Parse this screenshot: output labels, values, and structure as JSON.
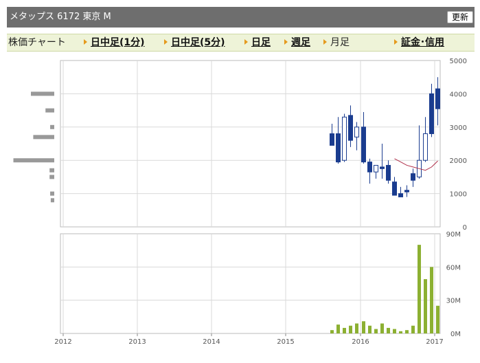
{
  "header": {
    "title": "メタップス 6172 東京 M",
    "refresh_label": "更新"
  },
  "nav": {
    "label": "株価チャート",
    "items": [
      {
        "label": "日中足(1分)",
        "link": true
      },
      {
        "label": "日中足(5分)",
        "link": true
      },
      {
        "label": "日足",
        "link": true
      },
      {
        "label": "週足",
        "link": true
      },
      {
        "label": "月足",
        "link": false
      },
      {
        "label": "証金･信用",
        "link": true
      }
    ]
  },
  "colors": {
    "down_candle": "#1a3c8f",
    "up_candle_fill": "#ffffff",
    "moving_average": "#b0304a",
    "volume_bar": "#8cb032",
    "volume_profile": "#999999",
    "grid": "#d9d9d9",
    "frame": "#bbbbbb"
  },
  "chart_data": [
    {
      "type": "candlestick",
      "x_ticks": [
        "2012",
        "2013",
        "2014",
        "2015",
        "2016",
        "2017"
      ],
      "y_ticks": [
        "0",
        "1000",
        "2000",
        "3000",
        "4000",
        "5000"
      ],
      "ylim": [
        0,
        5000
      ],
      "months": [
        "2015-08",
        "2015-09",
        "2015-10",
        "2015-11",
        "2015-12",
        "2016-01",
        "2016-02",
        "2016-03",
        "2016-04",
        "2016-05",
        "2016-06",
        "2016-07",
        "2016-08",
        "2016-09",
        "2016-10",
        "2016-11",
        "2016-12",
        "2017-01"
      ],
      "open": [
        2800,
        2800,
        2000,
        3350,
        2700,
        3000,
        1950,
        1650,
        1800,
        1850,
        1350,
        1000,
        1100,
        1600,
        1500,
        2000,
        4000,
        4150
      ],
      "high": [
        3100,
        3300,
        3400,
        3650,
        3150,
        3450,
        2050,
        1800,
        2500,
        2000,
        1500,
        1200,
        1250,
        1750,
        3050,
        3300,
        4300,
        4500
      ],
      "low": [
        2500,
        1900,
        1950,
        2400,
        2300,
        1900,
        1300,
        1450,
        1450,
        1300,
        950,
        900,
        900,
        1200,
        1450,
        1950,
        2700,
        3050
      ],
      "close": [
        2450,
        1950,
        3300,
        2600,
        3000,
        1950,
        1650,
        1850,
        1750,
        1400,
        950,
        900,
        1050,
        1400,
        2000,
        2800,
        2800,
        3550
      ],
      "moving_average": {
        "months": [
          "2016-06",
          "2016-07",
          "2016-08",
          "2016-09",
          "2016-10",
          "2016-11",
          "2016-12",
          "2017-01"
        ],
        "values": [
          2050,
          1950,
          1850,
          1800,
          1750,
          1700,
          1800,
          1980
        ]
      },
      "volume_profile": {
        "price_levels": [
          4000,
          3500,
          3000,
          2700,
          2000,
          1700,
          1500,
          1000,
          800
        ],
        "relative_volume": [
          0.4,
          0.15,
          0.07,
          0.36,
          0.7,
          0.08,
          0.08,
          0.07,
          0.06
        ]
      }
    },
    {
      "type": "bar",
      "title": "volume",
      "y_ticks": [
        "0M",
        "30M",
        "60M",
        "90M"
      ],
      "ylim": [
        0,
        90
      ],
      "months": [
        "2015-08",
        "2015-09",
        "2015-10",
        "2015-11",
        "2015-12",
        "2016-01",
        "2016-02",
        "2016-03",
        "2016-04",
        "2016-05",
        "2016-06",
        "2016-07",
        "2016-08",
        "2016-09",
        "2016-10",
        "2016-11",
        "2016-12",
        "2017-01"
      ],
      "values": [
        3,
        8,
        5,
        7,
        9,
        11,
        7,
        4,
        9,
        5,
        4,
        2,
        3,
        7,
        80,
        49,
        60,
        25
      ]
    }
  ]
}
